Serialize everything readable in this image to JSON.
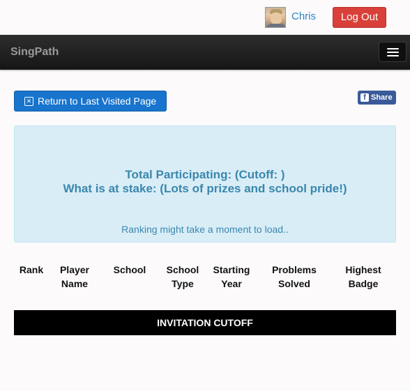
{
  "header": {
    "username": "Chris",
    "logout_label": "Log Out"
  },
  "navbar": {
    "brand": "SingPath",
    "menu_icon": "hamburger-icon"
  },
  "actions": {
    "return_label": "Return to Last Visited Page",
    "return_icon": "return-icon",
    "share_label": "Share",
    "share_icon": "facebook-icon"
  },
  "info_panel": {
    "participating": "Total Participating: (Cutoff: )",
    "stake": "What is at stake: (Lots of prizes and school pride!)",
    "loading": "Ranking might take a moment to load.."
  },
  "table": {
    "headers": [
      [
        "Rank"
      ],
      [
        "Player",
        "Name"
      ],
      [
        "School"
      ],
      [
        "School",
        "Type"
      ],
      [
        "Starting",
        "Year"
      ],
      [
        "Problems",
        "Solved"
      ],
      [
        "Highest",
        "Badge"
      ]
    ],
    "cutoff_label": "INVITATION CUTOFF"
  },
  "colors": {
    "primary": "#1874cd",
    "danger": "#d9403a",
    "info_bg": "#d9edf7",
    "info_text": "#3a87ad",
    "facebook": "#3b5a9a"
  }
}
